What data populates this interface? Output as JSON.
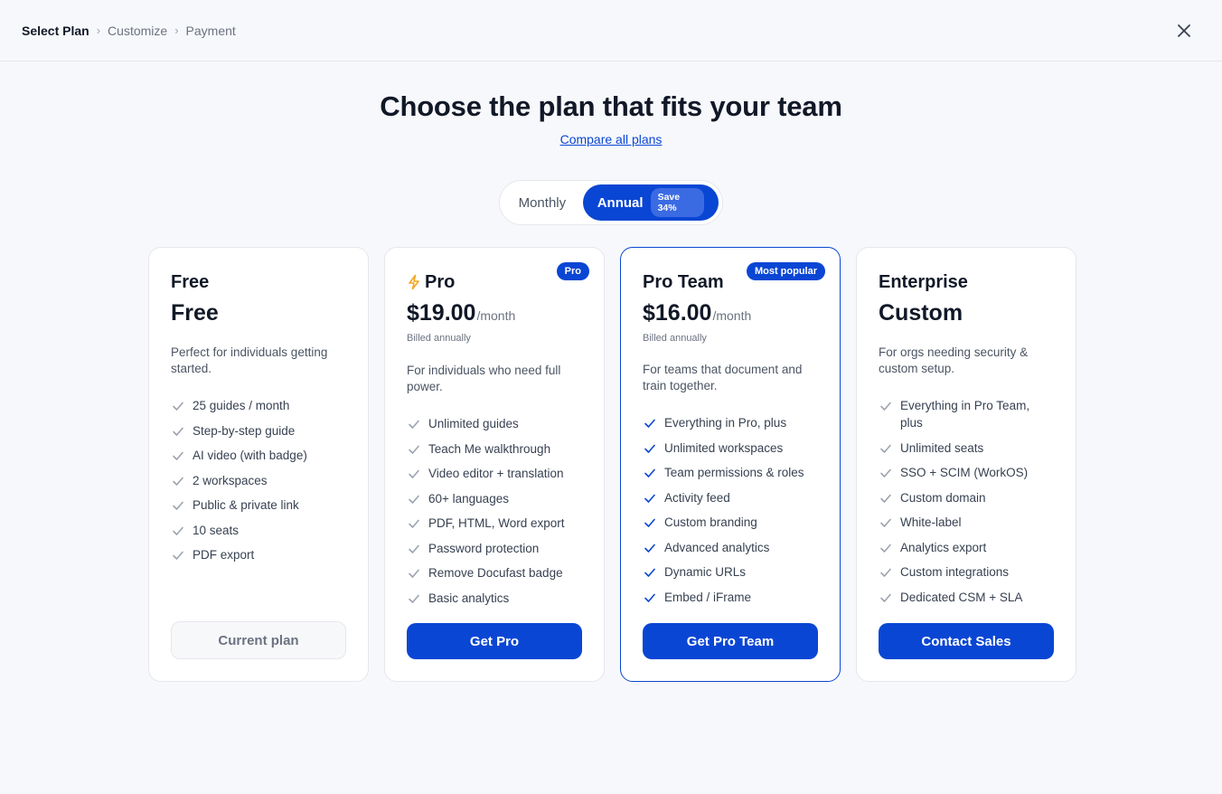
{
  "breadcrumb": {
    "steps": [
      "Select Plan",
      "Customize",
      "Payment"
    ],
    "separator": "›"
  },
  "header": {
    "title": "Choose the plan that fits your team",
    "compare_link": "Compare all plans"
  },
  "billing_toggle": {
    "monthly_label": "Monthly",
    "annual_label": "Annual",
    "save_badge": "Save 34%",
    "selected": "Annual"
  },
  "colors": {
    "accent": "#0a46d4",
    "bolt": "#f5a623",
    "check_featured": "#0a46d4",
    "check_default": "#9ca3af"
  },
  "plans": [
    {
      "name": "Free",
      "price": "Free",
      "per": "",
      "billed": "",
      "badge": "",
      "description": "Perfect for individuals getting started.",
      "features": [
        "25 guides / month",
        "Step-by-step guide",
        "AI video (with badge)",
        "2 workspaces",
        "Public & private link",
        "10 seats",
        "PDF export"
      ],
      "cta": "Current plan"
    },
    {
      "name": "Pro",
      "price": "$19.00",
      "per": "/month",
      "billed": "Billed annually",
      "badge": "Pro",
      "icon": "bolt-icon",
      "description": "For individuals who need full power.",
      "features": [
        "Unlimited guides",
        "Teach Me walkthrough",
        "Video editor + translation",
        "60+ languages",
        "PDF, HTML, Word export",
        "Password protection",
        "Remove Docufast badge",
        "Basic analytics"
      ],
      "cta": "Get Pro"
    },
    {
      "name": "Pro Team",
      "price": "$16.00",
      "per": "/month",
      "billed": "Billed annually",
      "badge": "Most popular",
      "description": "For teams that document and train together.",
      "features": [
        "Everything in Pro, plus",
        "Unlimited workspaces",
        "Team permissions & roles",
        "Activity feed",
        "Custom branding",
        "Advanced analytics",
        "Dynamic URLs",
        "Embed / iFrame"
      ],
      "cta": "Get Pro Team"
    },
    {
      "name": "Enterprise",
      "price": "Custom",
      "per": "",
      "billed": "",
      "badge": "",
      "description": "For orgs needing security & custom setup.",
      "features": [
        "Everything in Pro Team, plus",
        "Unlimited seats",
        "SSO + SCIM (WorkOS)",
        "Custom domain",
        "White-label",
        "Analytics export",
        "Custom integrations",
        "Dedicated CSM + SLA"
      ],
      "cta": "Contact Sales"
    }
  ]
}
